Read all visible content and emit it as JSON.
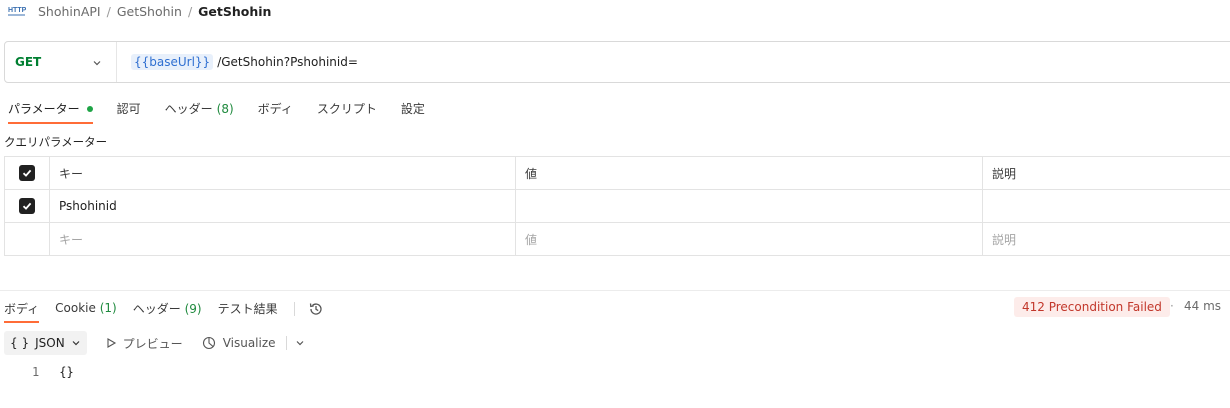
{
  "breadcrumb": {
    "items": [
      "ShohinAPI",
      "GetShohin"
    ],
    "separator": "/",
    "current": "GetShohin"
  },
  "request": {
    "method": "GET",
    "url_variable": "{{baseUrl}}",
    "url_path": "/GetShohin?Pshohinid="
  },
  "request_tabs": [
    {
      "label": "パラメーター",
      "active": true,
      "indicator": true
    },
    {
      "label": "認可"
    },
    {
      "label": "ヘッダー",
      "count": "(8)"
    },
    {
      "label": "ボディ"
    },
    {
      "label": "スクリプト"
    },
    {
      "label": "設定"
    }
  ],
  "params": {
    "title": "クエリパラメーター",
    "headers": {
      "key": "キー",
      "value": "値",
      "description": "説明"
    },
    "rows": [
      {
        "checked": true,
        "key": "Pshohinid",
        "value": "",
        "description": ""
      }
    ],
    "placeholders": {
      "key": "キー",
      "value": "値",
      "description": "説明"
    }
  },
  "response_tabs": [
    {
      "label": "ボディ",
      "active": true
    },
    {
      "label": "Cookie",
      "count": "(1)"
    },
    {
      "label": "ヘッダー",
      "count": "(9)"
    },
    {
      "label": "テスト結果"
    }
  ],
  "response": {
    "status": "412 Precondition Failed",
    "separator": "·",
    "time": "44 ms",
    "status_color": "#c2372b"
  },
  "response_toolbar": {
    "format_icon": "{ }",
    "format_label": "JSON",
    "preview_label": "プレビュー",
    "visualize_label": "Visualize"
  },
  "code": {
    "lines": [
      {
        "no": "1",
        "text": "{}"
      }
    ]
  },
  "colors": {
    "method": "#007f31",
    "accent": "#ff6c37",
    "count": "#1f8a3e",
    "variable": "#2f6fd1"
  }
}
